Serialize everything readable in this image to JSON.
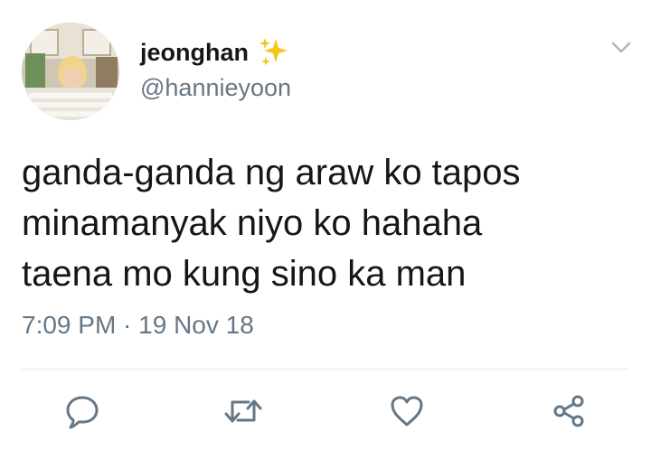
{
  "tweet": {
    "display_name": "jeonghan",
    "handle": "@hannieyoon",
    "text": "ganda-ganda ng araw ko tapos\nminamanyak niyo ko hahaha\ntaena mo kung sino ka man",
    "timestamp": "7:09 PM · 19 Nov 18"
  },
  "icons": {
    "sparkles": "sparkles-icon",
    "caret": "chevron-down-icon",
    "reply": "reply-icon",
    "retweet": "retweet-icon",
    "like": "heart-icon",
    "share": "share-icon"
  },
  "colors": {
    "text": "#14171a",
    "secondary": "#657786",
    "divider": "#e1e8ed",
    "sparkle": "#f5c518"
  }
}
